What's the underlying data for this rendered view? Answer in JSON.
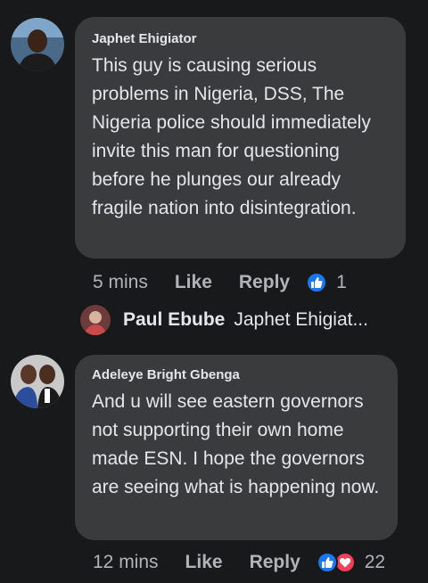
{
  "comments": [
    {
      "author": "Japhet Ehigiator",
      "text": "This guy is  causing serious problems in Nigeria, DSS, The Nigeria police should immediately invite this man for questioning before he plunges our already fragile nation into disintegration.",
      "time": "5 mins",
      "like_label": "Like",
      "reply_label": "Reply",
      "reaction_count": "1",
      "reactions": [
        "like-icon"
      ]
    },
    {
      "author": "Adeleye Bright Gbenga",
      "text": "And u will see eastern governors not supporting their own home made ESN. I hope the governors are seeing what is happening now.",
      "time": "12 mins",
      "like_label": "Like",
      "reply_label": "Reply",
      "reaction_count": "22",
      "reactions": [
        "like-icon",
        "love-icon"
      ]
    }
  ],
  "reply_preview": {
    "author": "Paul Ebube",
    "text": "Japhet Ehigiat..."
  },
  "colors": {
    "background": "#18191a",
    "bubble": "#3a3b3c",
    "like_blue": "#1877f2",
    "love_red": "#f33e58",
    "muted_text": "#b0b3b8"
  }
}
